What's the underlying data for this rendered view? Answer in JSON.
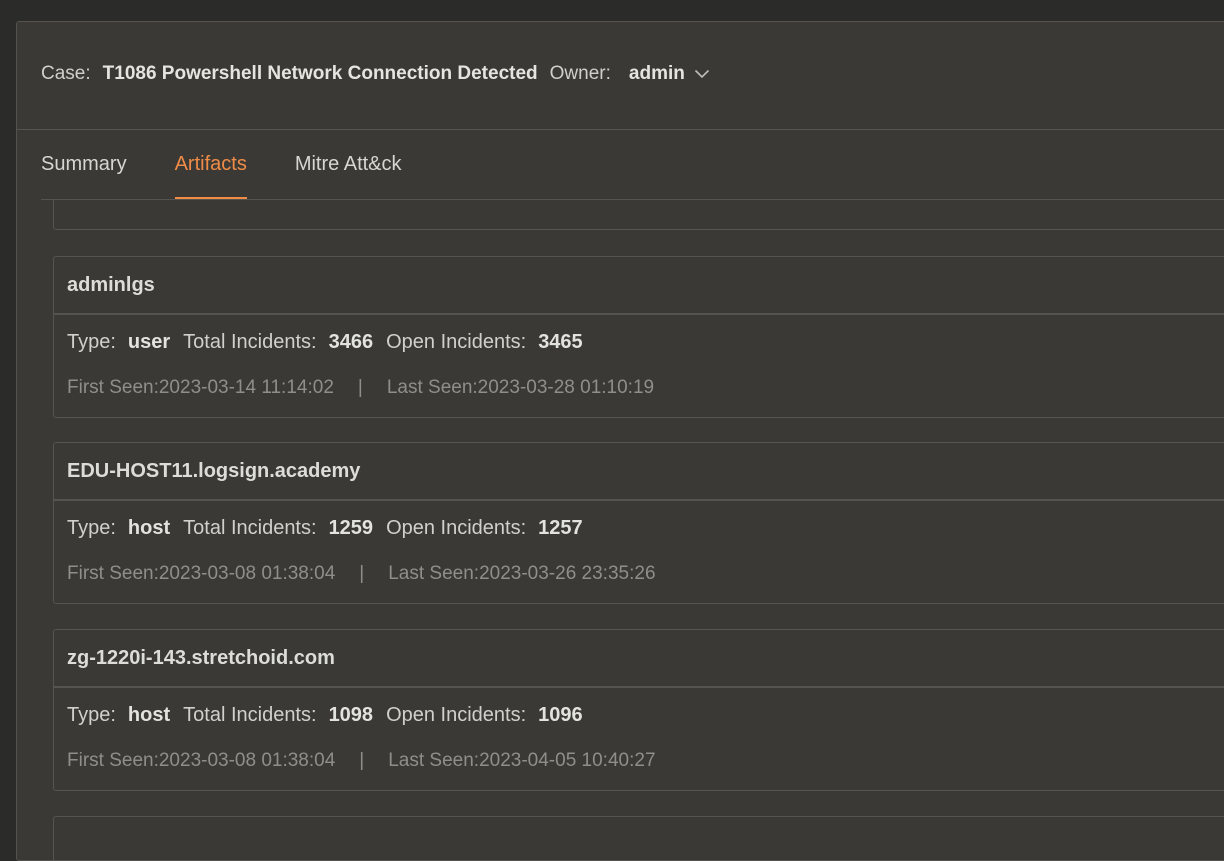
{
  "header": {
    "case_label": "Case:",
    "case_title": "T1086 Powershell Network Connection Detected",
    "owner_label": "Owner:",
    "owner_value": "admin",
    "owner_dropdown_icon": "chevron-down-icon"
  },
  "tabs": [
    {
      "label": "Summary",
      "active": false
    },
    {
      "label": "Artifacts",
      "active": true
    },
    {
      "label": "Mitre Att&ck",
      "active": false
    }
  ],
  "colors": {
    "accent": "#f08c46",
    "panel_bg": "#3a3935",
    "page_bg": "#2b2b29"
  },
  "artifacts": [
    {
      "name": "adminlgs",
      "type_label": "Type:",
      "type": "user",
      "total_label": "Total Incidents:",
      "total": "3466",
      "open_label": "Open Incidents:",
      "open": "3465",
      "first_seen": "First Seen:2023-03-14 11:14:02",
      "separator": "|",
      "last_seen": "Last Seen:2023-03-28 01:10:19"
    },
    {
      "name": "EDU-HOST11.logsign.academy",
      "type_label": "Type:",
      "type": "host",
      "total_label": "Total Incidents:",
      "total": "1259",
      "open_label": "Open Incidents:",
      "open": "1257",
      "first_seen": "First Seen:2023-03-08 01:38:04",
      "separator": "|",
      "last_seen": "Last Seen:2023-03-26 23:35:26"
    },
    {
      "name": "zg-1220i-143.stretchoid.com",
      "type_label": "Type:",
      "type": "host",
      "total_label": "Total Incidents:",
      "total": "1098",
      "open_label": "Open Incidents:",
      "open": "1096",
      "first_seen": "First Seen:2023-03-08 01:38:04",
      "separator": "|",
      "last_seen": "Last Seen:2023-04-05 10:40:27"
    }
  ]
}
